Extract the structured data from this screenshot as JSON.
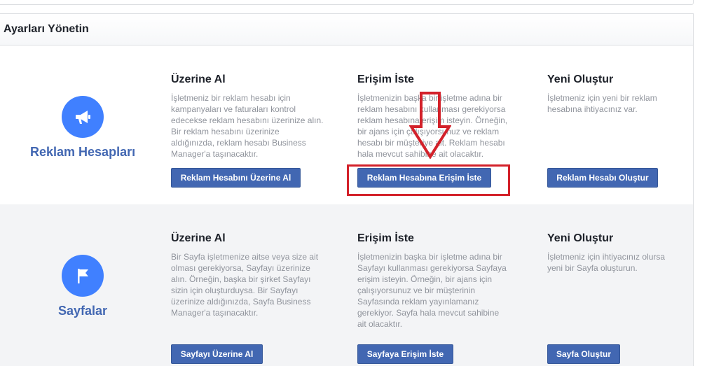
{
  "panel": {
    "title": "Ayarları Yönetin"
  },
  "sections": [
    {
      "name": "ads",
      "label": "Reklam Hesapları",
      "icon": "megaphone-icon",
      "columns": [
        {
          "title": "Üzerine Al",
          "desc": "İşletmeniz bir reklam hesabı için kampanyaları ve faturaları kontrol edecekse reklam hesabını üzerinize alın. Bir reklam hesabını üzerinize aldığınızda, reklam hesabı Business Manager'a taşınacaktır.",
          "button": "Reklam Hesabını Üzerine Al"
        },
        {
          "title": "Erişim İste",
          "desc": "İşletmenizin başka bir işletme adına bir reklam hesabını kullanması gerekiyorsa reklam hesabına erişim isteyin. Örneğin, bir ajans için çalışıyorsunuz ve reklam hesabı bir müşteriye ait. Reklam hesabı hala mevcut sahibine ait olacaktır.",
          "button": "Reklam Hesabına Erişim İste"
        },
        {
          "title": "Yeni Oluştur",
          "desc": "İşletmeniz için yeni bir reklam hesabına ihtiyacınız var.",
          "button": "Reklam Hesabı Oluştur"
        }
      ]
    },
    {
      "name": "pages",
      "label": "Sayfalar",
      "icon": "flag-icon",
      "columns": [
        {
          "title": "Üzerine Al",
          "desc": "Bir Sayfa işletmenize aitse veya size ait olması gerekiyorsa, Sayfayı üzerinize alın. Örneğin, başka bir şirket Sayfayı sizin için oluşturduysa. Bir Sayfayı üzerinize aldığınızda, Sayfa Business Manager'a taşınacaktır.",
          "button": "Sayfayı Üzerine Al"
        },
        {
          "title": "Erişim İste",
          "desc": "İşletmenizin başka bir işletme adına bir Sayfayı kullanması gerekiyorsa Sayfaya erişim isteyin. Örneğin, bir ajans için çalışıyorsunuz ve bir müşterinin Sayfasında reklam yayınlamanız gerekiyor. Sayfa hala mevcut sahibine ait olacaktır.",
          "button": "Sayfaya Erişim İste"
        },
        {
          "title": "Yeni Oluştur",
          "desc": "İşletmeniz için ihtiyacınız olursa yeni bir Sayfa oluşturun.",
          "button": "Sayfa Oluştur"
        }
      ]
    }
  ],
  "annotation": {
    "color": "#d3212a"
  },
  "colors": {
    "accent": "#4267b2",
    "icon_bg": "#4080ff"
  }
}
